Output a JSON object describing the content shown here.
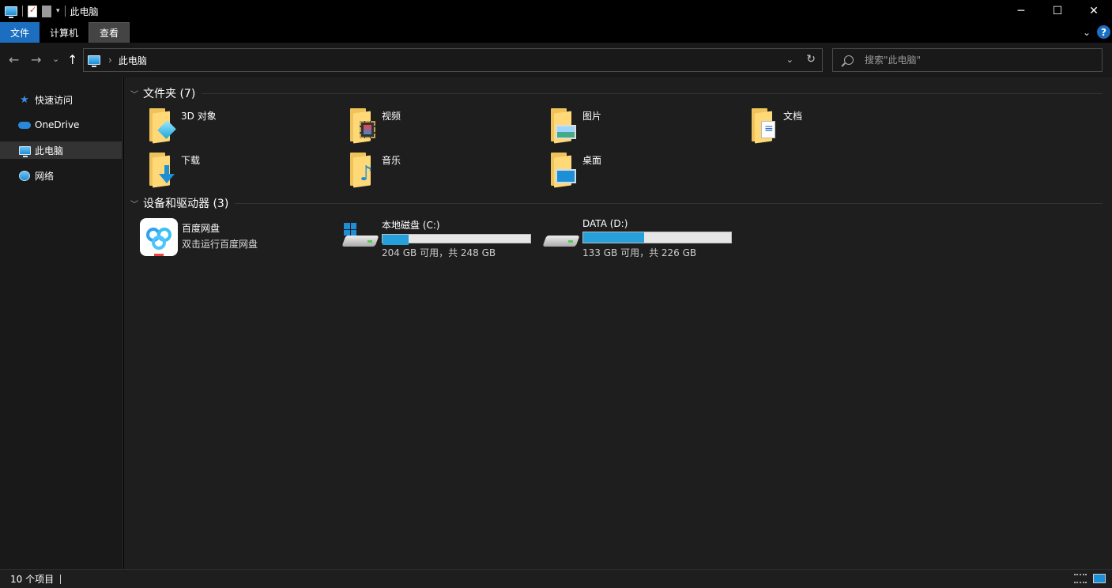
{
  "window": {
    "title": "此电脑",
    "controls": {
      "minimize": "─",
      "maximize": "☐",
      "close": "✕"
    }
  },
  "ribbon": {
    "tabs": [
      {
        "label": "文件"
      },
      {
        "label": "计算机"
      },
      {
        "label": "查看"
      }
    ],
    "collapse_icon": "chevron-down-icon",
    "help_label": "?"
  },
  "address": {
    "back": "←",
    "forward": "→",
    "recent": "⌄",
    "up": "↑",
    "breadcrumb_sep": "›",
    "path": "此电脑",
    "dropdown": "⌄",
    "refresh": "↻"
  },
  "search": {
    "placeholder": "搜索\"此电脑\""
  },
  "navpane": {
    "items": [
      {
        "label": "快速访问",
        "icon": "star-icon"
      },
      {
        "label": "OneDrive",
        "icon": "cloud-icon"
      },
      {
        "label": "此电脑",
        "icon": "computer-icon",
        "selected": true
      },
      {
        "label": "网络",
        "icon": "network-icon"
      }
    ]
  },
  "content": {
    "folders_header": "文件夹 (7)",
    "folders": [
      {
        "label": "3D 对象",
        "icon": "3d-objects-folder-icon"
      },
      {
        "label": "视频",
        "icon": "videos-folder-icon"
      },
      {
        "label": "图片",
        "icon": "pictures-folder-icon"
      },
      {
        "label": "文档",
        "icon": "documents-folder-icon"
      },
      {
        "label": "下载",
        "icon": "downloads-folder-icon"
      },
      {
        "label": "音乐",
        "icon": "music-folder-icon"
      },
      {
        "label": "桌面",
        "icon": "desktop-folder-icon"
      }
    ],
    "devices_header": "设备和驱动器 (3)",
    "baidu": {
      "label": "百度网盘",
      "sub": "双击运行百度网盘"
    },
    "drives": [
      {
        "name": "本地磁盘 (C:)",
        "free_text": "204 GB 可用，共 248 GB",
        "used_fraction": 0.177,
        "bar_color": "#26a0da"
      },
      {
        "name": "DATA (D:)",
        "free_text": "133 GB 可用，共 226 GB",
        "used_fraction": 0.412,
        "bar_color": "#26a0da"
      }
    ]
  },
  "status": {
    "count": "10 个项目"
  }
}
